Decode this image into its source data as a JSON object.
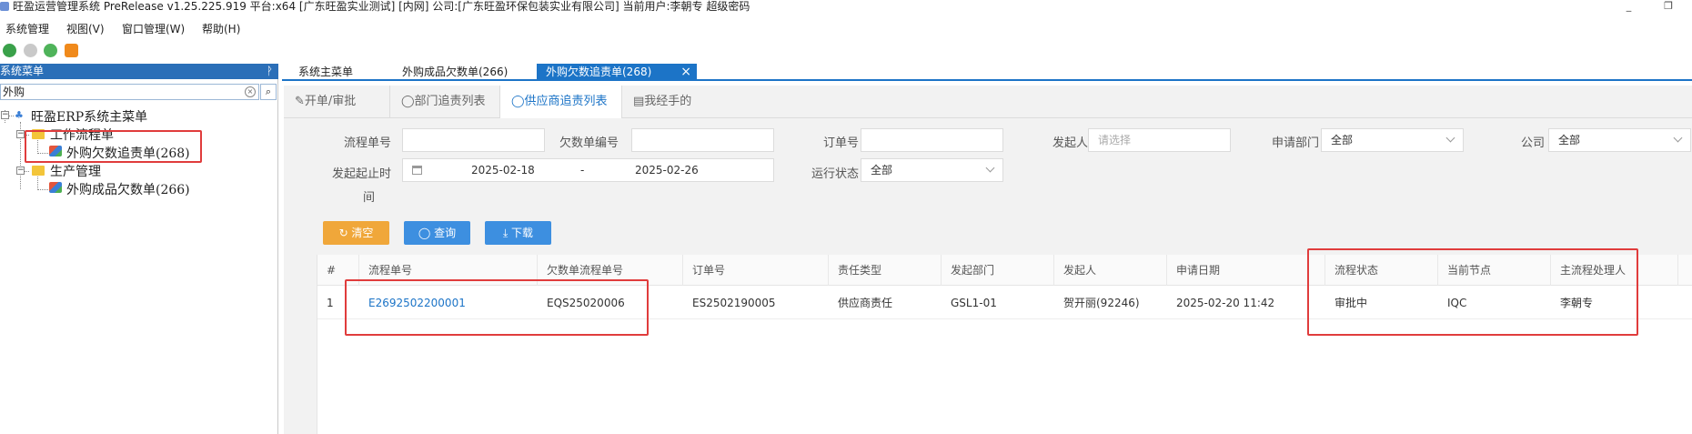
{
  "window": {
    "title": "旺盈运营管理系统 PreRelease v1.25.225.919 平台:x64  [广东旺盈实业测试] [内网] 公司:[广东旺盈环保包装实业有限公司] 当前用户:李朝专  超级密码",
    "minimize": "_",
    "restore": "❐"
  },
  "menu": {
    "items": [
      "系统管理",
      "视图(V)",
      "窗口管理(W)",
      "帮助(H)"
    ]
  },
  "toolbar": {
    "icons": [
      "back-icon",
      "forward-icon",
      "refresh-icon",
      "settings-gear-icon"
    ]
  },
  "sidebar": {
    "header": "系统菜单",
    "pin": "ᚹ",
    "search_value": "外购",
    "clear": "×",
    "search_btn": "⌕",
    "tree": {
      "root": "旺盈ERP系统主菜单",
      "group1": "工作流程单",
      "item1": "外购欠数追责单(268)",
      "group2": "生产管理",
      "item2": "外购成品欠数单(266)"
    }
  },
  "tabs": {
    "items": [
      "系统主菜单",
      "外购成品欠数单(266)",
      "外购欠数追责单(268)"
    ],
    "close": "×"
  },
  "subtabs": {
    "items": [
      "✎开单/审批",
      "◯部门追责列表",
      "◯供应商追责列表",
      "▤我经手的"
    ]
  },
  "form": {
    "flow_no_label": "流程单号",
    "owe_no_label": "欠数单编号",
    "order_no_label": "订单号",
    "initiator_label": "发起人",
    "initiator_placeholder": "请选择",
    "dept_label": "申请部门",
    "dept_value": "全部",
    "company_label": "公司",
    "company_value": "全部",
    "range_label_1": "发起起止时",
    "range_label_2": "间",
    "date_start": "2025-02-18",
    "date_sep": "-",
    "date_end": "2025-02-26",
    "status_label": "运行状态",
    "status_value": "全部",
    "clear_btn": "↻ 清空",
    "query_btn": "◯ 查询",
    "download_btn": "⤓ 下载"
  },
  "table": {
    "headers": [
      "#",
      "流程单号",
      "欠数单流程单号",
      "订单号",
      "责任类型",
      "发起部门",
      "发起人",
      "申请日期",
      "流程状态",
      "当前节点",
      "主流程处理人"
    ],
    "rows": [
      [
        "1",
        "E2692502200001",
        "EQS25020006",
        "ES2502190005",
        "供应商责任",
        "GSL1-01",
        "贺开丽(92246)",
        "2025-02-20 11:42",
        "审批中",
        "IQC",
        "李朝专"
      ]
    ]
  },
  "colors": {
    "accent": "#1c74c7",
    "highlight_box": "#e03c3c",
    "clear_btn": "#f0a73a",
    "query_btn": "#3d8fe0",
    "download_btn": "#3d8fe0"
  }
}
